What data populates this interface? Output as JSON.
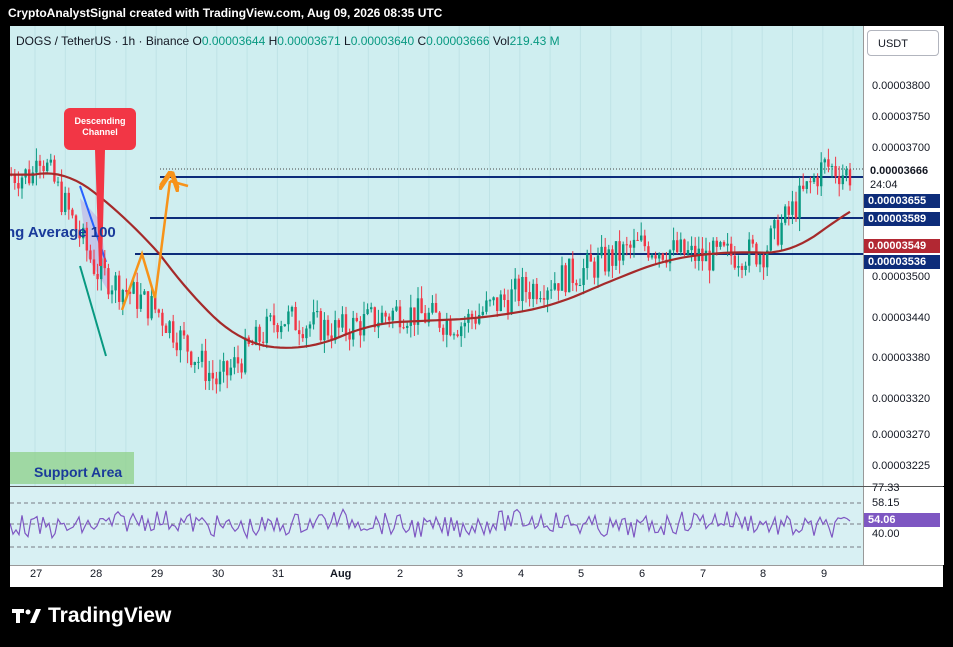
{
  "header": {
    "text": "CryptoAnalystSignal created with TradingView.com, Aug 09, 2026 08:35 UTC"
  },
  "legend": {
    "symbol": "DOGS / TetherUS · 1h · Binance",
    "o_label": "O",
    "o_value": "0.00003644",
    "h_label": "H",
    "h_value": "0.00003671",
    "l_label": "L",
    "l_value": "0.00003640",
    "c_label": "C",
    "c_value": "0.00003666",
    "vol_label": "Vol",
    "vol_value": "219.43 M"
  },
  "currency_button": "USDT",
  "price_axis": [
    "0.00003800",
    "0.00003750",
    "0.00003700",
    "0.00003500",
    "0.00003440",
    "0.00003380",
    "0.00003320",
    "0.00003270",
    "0.00003225"
  ],
  "price_tags": {
    "current": "0.00003666",
    "countdown": "24:04",
    "level1": "0.00003655",
    "level2": "0.00003589",
    "ma": "0.00003549",
    "level3": "0.00003536"
  },
  "rsi_axis": [
    "77.33",
    "58.15",
    "40.00"
  ],
  "rsi_value": "54.06",
  "time_axis": [
    "27",
    "28",
    "29",
    "30",
    "31",
    "Aug",
    "2",
    "3",
    "4",
    "5",
    "6",
    "7",
    "8",
    "9"
  ],
  "annotations": {
    "descending_channel": "Descending Channel",
    "moving_average": "ng Average 100",
    "support_area": "Support Area"
  },
  "brand": "TradingView",
  "colors": {
    "up": "#089981",
    "down": "#f23645",
    "ma": "#a52a2a",
    "level": "#0d2c7a",
    "rsi": "#7e57c2",
    "arrow": "#f7931a"
  },
  "chart_data": {
    "type": "candlestick",
    "x_ticks": [
      "27",
      "28",
      "29",
      "30",
      "31",
      "Aug",
      "2",
      "3",
      "4",
      "5",
      "6",
      "7",
      "8",
      "9"
    ],
    "y_ticks": [
      3.8e-05,
      3.75e-05,
      3.7e-05,
      3.5e-05,
      3.44e-05,
      3.38e-05,
      3.32e-05,
      3.27e-05,
      3.225e-05
    ],
    "close_path": [
      [
        "27",
        3.71e-05
      ],
      [
        "28",
        3.52e-05
      ],
      [
        "29",
        3.46e-05
      ],
      [
        "30",
        3.35e-05
      ],
      [
        "31",
        3.45e-05
      ],
      [
        "Aug",
        3.43e-05
      ],
      [
        "2",
        3.46e-05
      ],
      [
        "3",
        3.44e-05
      ],
      [
        "4",
        3.49e-05
      ],
      [
        "5",
        3.52e-05
      ],
      [
        "6",
        3.56e-05
      ],
      [
        "7",
        3.54e-05
      ],
      [
        "8",
        3.55e-05
      ],
      [
        "9",
        3.68e-05
      ]
    ],
    "last_close": 3.666e-05,
    "levels": [
      3.655e-05,
      3.589e-05,
      3.536e-05
    ],
    "moving_average_last": 3.549e-05,
    "rsi_levels": [
      77.33,
      58.15,
      40.0
    ],
    "rsi_last": 54.06
  }
}
